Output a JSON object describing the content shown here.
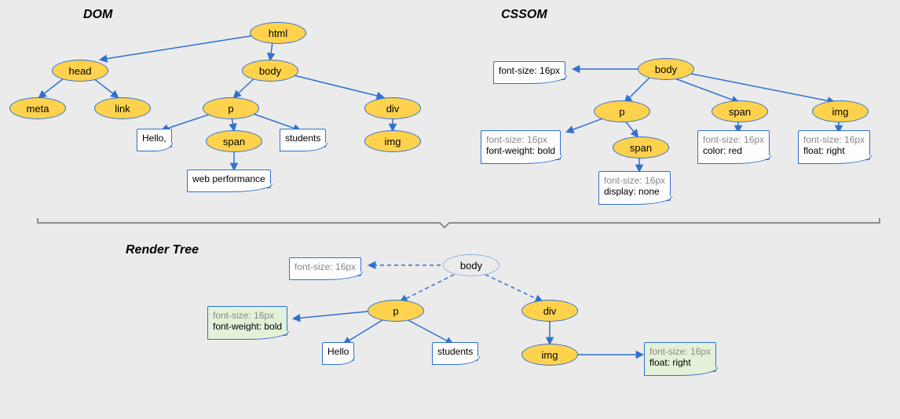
{
  "titles": {
    "dom": "DOM",
    "cssom": "CSSOM",
    "render": "Render Tree"
  },
  "dom": {
    "html": "html",
    "head": "head",
    "body": "body",
    "meta": "meta",
    "link": "link",
    "p": "p",
    "div": "div",
    "span": "span",
    "img": "img",
    "hello": "Hello,",
    "students": "students",
    "webperf": "web performance"
  },
  "cssom": {
    "body": "body",
    "p": "p",
    "span": "span",
    "img": "img",
    "span2": "span",
    "body_css": "font-size: 16px",
    "p_css": {
      "l1": "font-size: 16px",
      "l2": "font-weight: bold"
    },
    "span_css": {
      "l1": "font-size: 16px",
      "l2": "color: red"
    },
    "img_css": {
      "l1": "font-size: 16px",
      "l2": "float: right"
    },
    "span2_css": {
      "l1": "font-size: 16px",
      "l2": "display: none"
    }
  },
  "render": {
    "body": "body",
    "p": "p",
    "div": "div",
    "img": "img",
    "hello": "Hello",
    "students": "students",
    "body_css": "font-size: 16px",
    "p_css": {
      "l1": "font-size: 16px",
      "l2": "font-weight: bold"
    },
    "img_css": {
      "l1": "font-size: 16px",
      "l2": "float: right"
    }
  }
}
